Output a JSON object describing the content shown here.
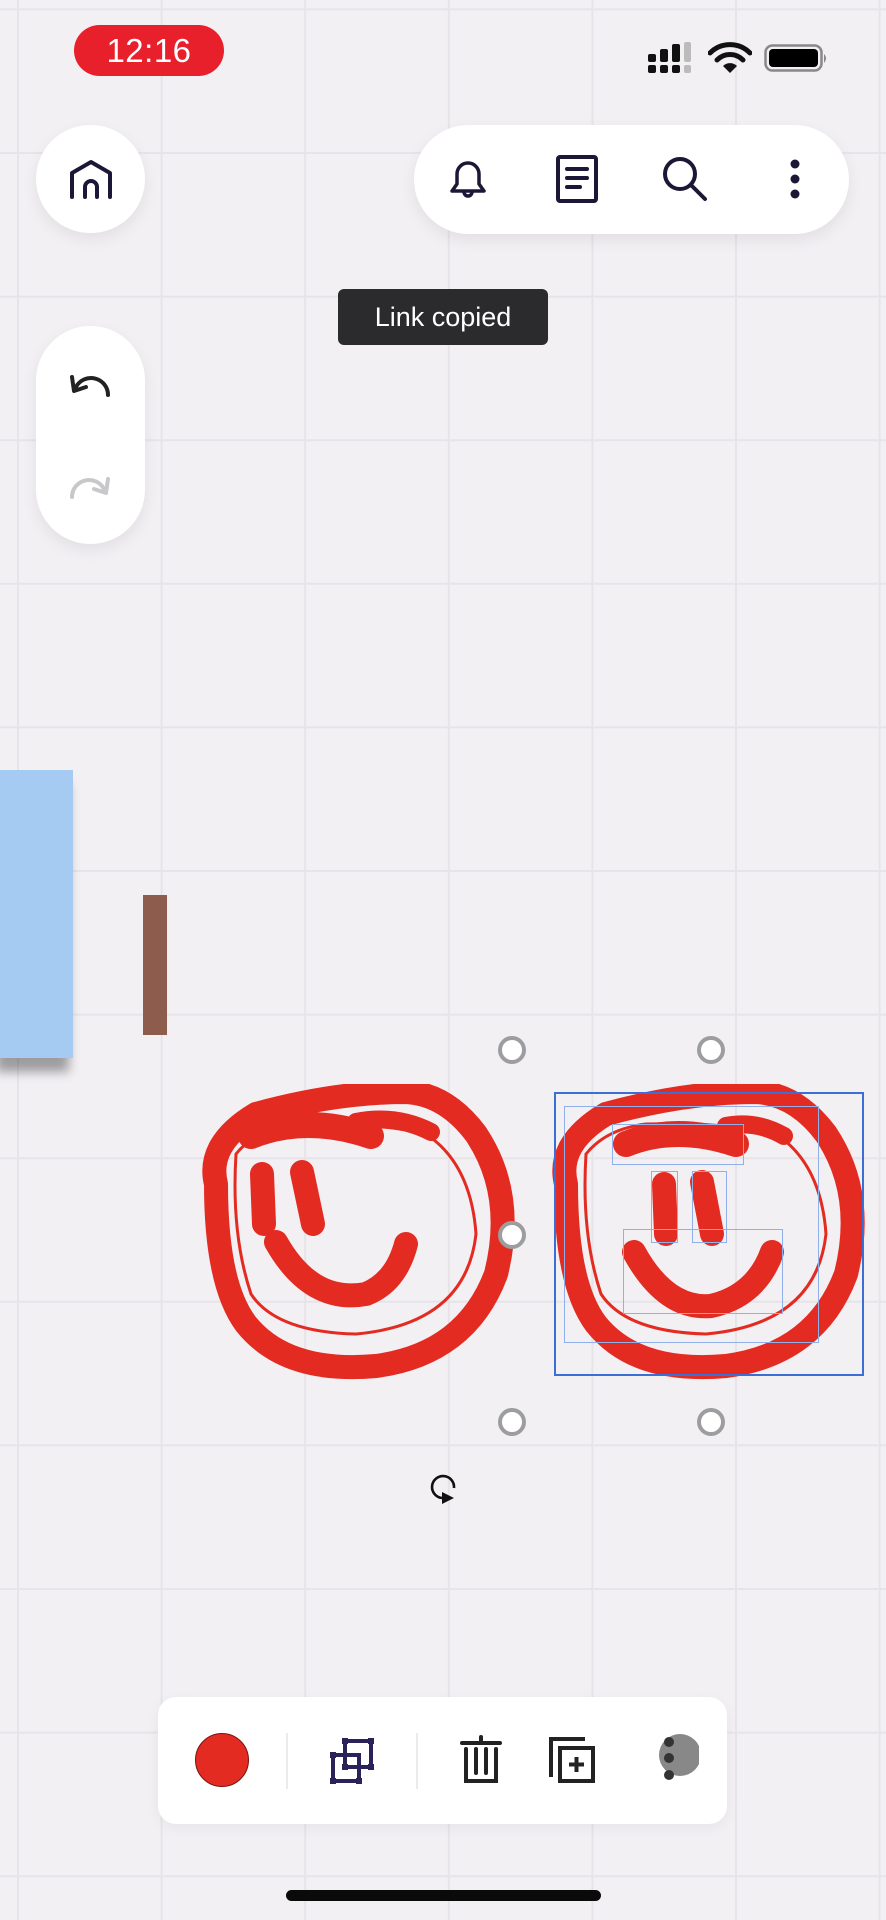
{
  "status_bar": {
    "time": "12:16",
    "signal_icon": "cellular-signal-icon",
    "wifi_icon": "wifi-icon",
    "battery_icon": "battery-icon"
  },
  "top_left": {
    "home_icon": "home-icon"
  },
  "top_toolbar": {
    "items": [
      {
        "icon": "bell-icon",
        "label": "Notifications"
      },
      {
        "icon": "document-icon",
        "label": "Board info"
      },
      {
        "icon": "search-icon",
        "label": "Search"
      },
      {
        "icon": "more-vertical-icon",
        "label": "More"
      }
    ]
  },
  "toast": {
    "text": "Link copied"
  },
  "history": {
    "undo_icon": "undo-icon",
    "redo_icon": "redo-icon",
    "redo_enabled": false
  },
  "canvas": {
    "background": "#f2f0f3",
    "grid_color": "#e6e4e9",
    "objects": [
      {
        "type": "sticky-note",
        "color": "#a5cbf3"
      },
      {
        "type": "shape",
        "color": "#8d5c4c"
      },
      {
        "type": "drawing",
        "name": "smiley-face",
        "color": "#e32b22",
        "selected": false
      },
      {
        "type": "drawing",
        "name": "smiley-face",
        "color": "#e32b22",
        "selected": true
      }
    ],
    "selection_color": "#3b6fd6",
    "rotate_icon": "rotate-icon"
  },
  "bottom_toolbar": {
    "color_swatch": "#e32b22",
    "items": [
      {
        "icon": "color-swatch",
        "label": "Color"
      },
      {
        "icon": "group-icon",
        "label": "Group"
      },
      {
        "icon": "trash-icon",
        "label": "Delete"
      },
      {
        "icon": "duplicate-icon",
        "label": "Duplicate"
      },
      {
        "icon": "more-options-icon",
        "label": "More"
      }
    ]
  }
}
